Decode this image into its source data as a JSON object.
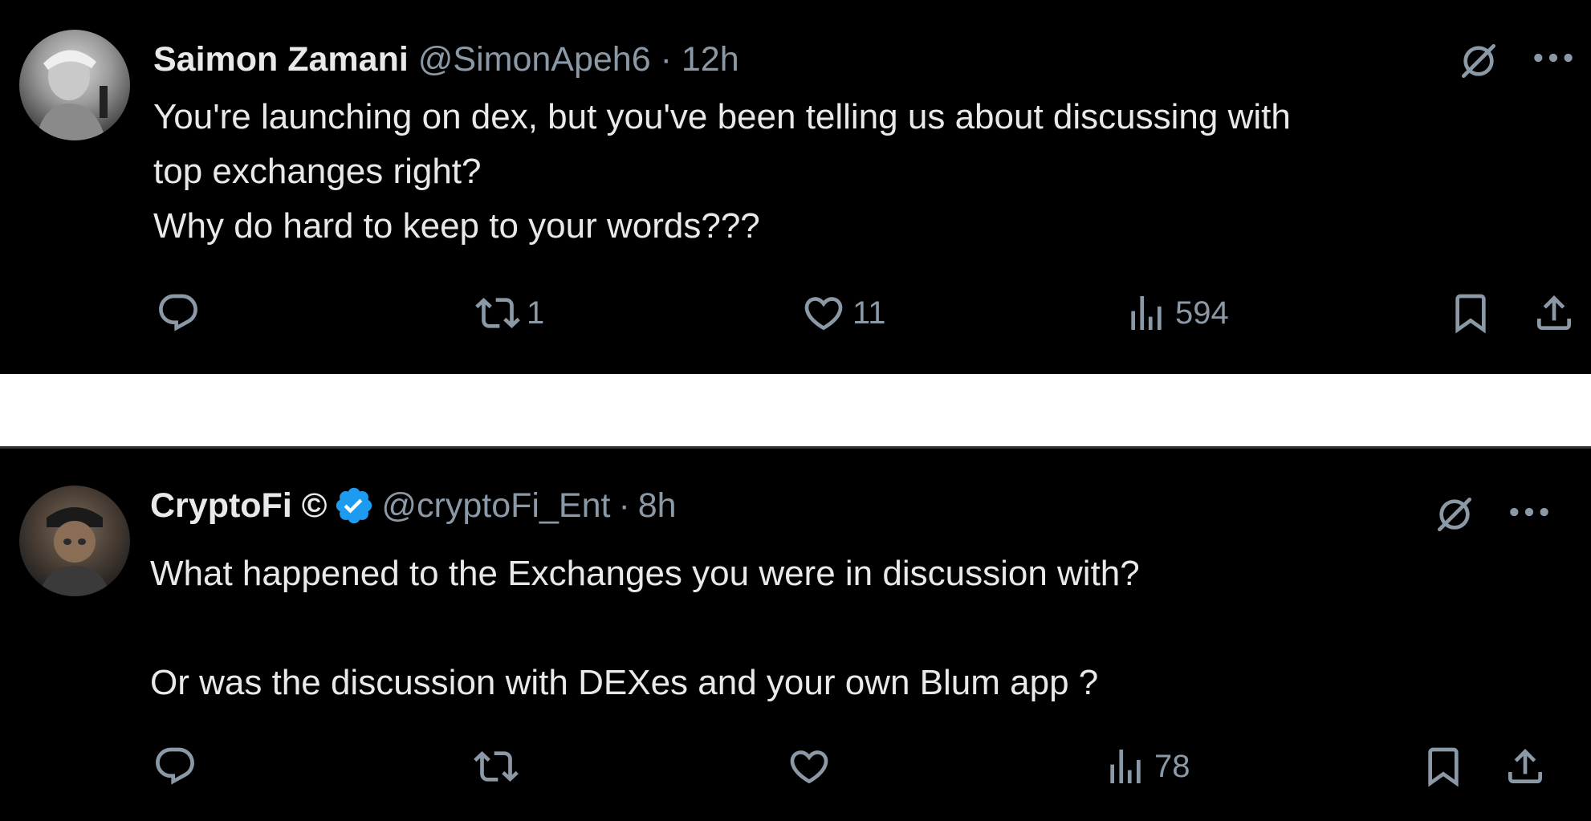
{
  "colors": {
    "background": "#000000",
    "separator": "#ffffff",
    "text_primary": "#e7e9ea",
    "text_secondary": "#8b98a5",
    "verified_badge": "#1d9bf0"
  },
  "tweets": [
    {
      "display_name": "Saimon Zamani",
      "handle": "@SimonApeh6",
      "separator": "·",
      "time": "12h",
      "body_lines": [
        "You're launching on dex, but you've been telling us about discussing with",
        "top exchanges right?",
        "Why do hard to keep to your words???"
      ],
      "icons": {
        "avatar": "user-avatar",
        "grok": "grok-icon",
        "more": "more-icon",
        "reply": "reply-icon",
        "retweet": "retweet-icon",
        "like": "like-icon",
        "views": "views-icon",
        "bookmark": "bookmark-icon",
        "share": "share-icon"
      },
      "actions": {
        "reply_count": "",
        "retweet_count": "1",
        "like_count": "11",
        "view_count": "594"
      }
    },
    {
      "display_name": "CryptoFi ©",
      "verified": true,
      "handle": "@cryptoFi_Ent",
      "separator": "·",
      "time": "8h",
      "body_lines": [
        "What happened to the Exchanges you were in discussion with?",
        "",
        "Or was the discussion with DEXes and your own Blum app ?"
      ],
      "icons": {
        "avatar": "user-avatar",
        "verified": "verified-badge-icon",
        "grok": "grok-icon",
        "more": "more-icon",
        "reply": "reply-icon",
        "retweet": "retweet-icon",
        "like": "like-icon",
        "views": "views-icon",
        "bookmark": "bookmark-icon",
        "share": "share-icon"
      },
      "actions": {
        "reply_count": "",
        "retweet_count": "",
        "like_count": "",
        "view_count": "78"
      }
    }
  ]
}
